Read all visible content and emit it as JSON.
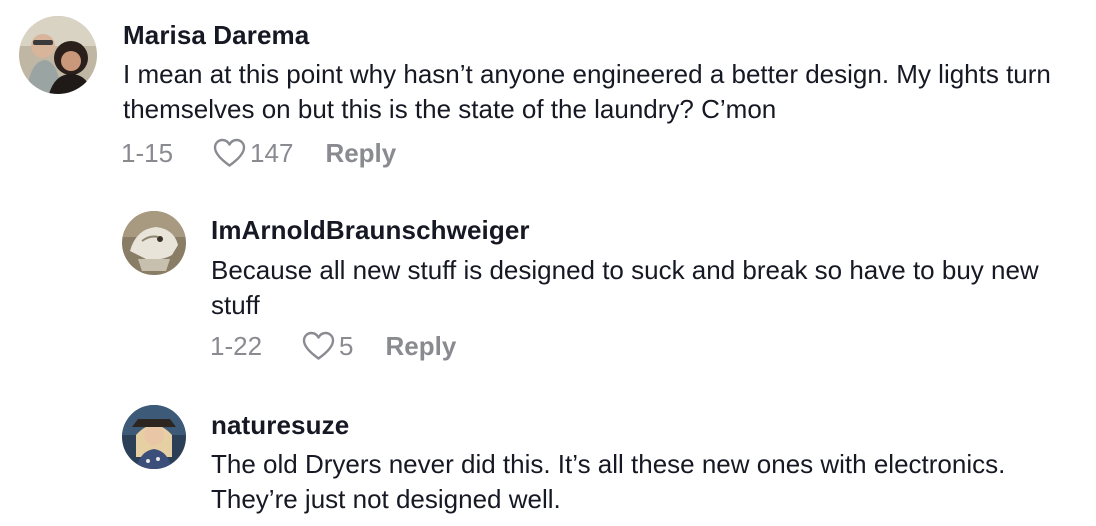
{
  "comments": [
    {
      "username": "Marisa Darema",
      "text": "I mean at this point why hasn’t anyone engineered a better design. My lights turn themselves on but this is the state of the laundry? C’mon",
      "date": "1-15",
      "likes": "147",
      "reply_label": "Reply"
    },
    {
      "username": "ImArnoldBraunschweiger",
      "text": "Because all new stuff is designed to suck and break so have to buy new stuff",
      "date": "1-22",
      "likes": "5",
      "reply_label": "Reply"
    },
    {
      "username": "naturesuze",
      "text": "The old Dryers never did this. It’s all these new ones with electronics. They’re just not designed well."
    }
  ],
  "colors": {
    "primary_text": "#161823",
    "secondary_text": "#8a8b91",
    "background": "#ffffff"
  },
  "icons": {
    "like": "heart-outline-icon"
  }
}
